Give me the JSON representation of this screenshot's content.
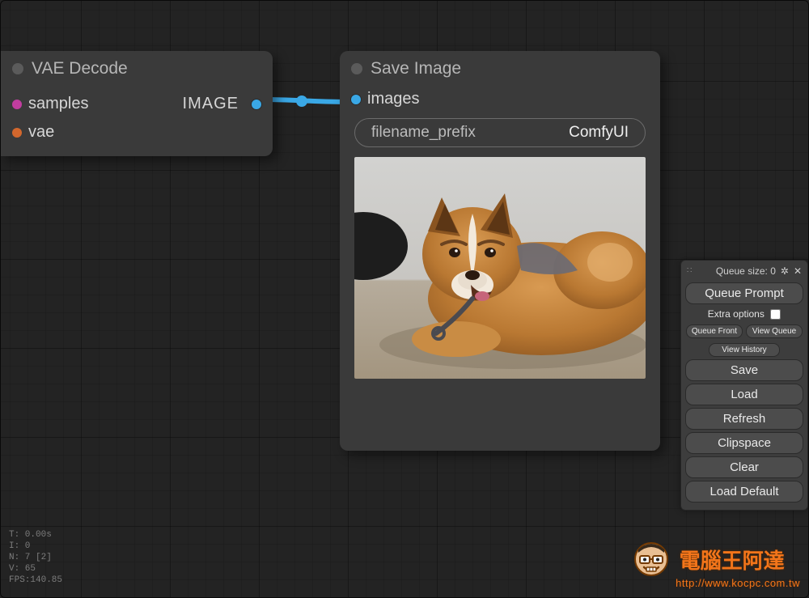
{
  "nodes": {
    "vae_decode": {
      "title": "VAE Decode",
      "inputs": {
        "samples": "samples",
        "vae": "vae"
      },
      "outputs": {
        "image": "IMAGE"
      }
    },
    "save_image": {
      "title": "Save Image",
      "inputs": {
        "images": "images"
      },
      "widget": {
        "key": "filename_prefix",
        "value": "ComfyUI"
      }
    }
  },
  "menu": {
    "queue_size_label": "Queue size: 0",
    "queue_prompt": "Queue Prompt",
    "extra_options": "Extra options",
    "queue_front": "Queue Front",
    "view_queue": "View Queue",
    "view_history": "View History",
    "save": "Save",
    "load": "Load",
    "refresh": "Refresh",
    "clipspace": "Clipspace",
    "clear": "Clear",
    "load_default": "Load Default"
  },
  "stats": {
    "t": "T: 0.00s",
    "i": "I: 0",
    "n": "N: 7 [2]",
    "v": "V: 65",
    "fps": "FPS:140.85"
  },
  "watermark": {
    "title": "電腦王阿達",
    "url": "http://www.kocpc.com.tw"
  }
}
